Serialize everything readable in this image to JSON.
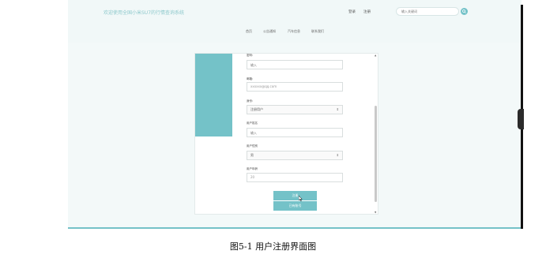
{
  "header": {
    "welcome": "欢迎使用全国小米SU7的行情查询系统",
    "login": "登录",
    "register": "注册",
    "search_placeholder": "输入关键词",
    "search_icon": "search-icon"
  },
  "nav": {
    "items": [
      {
        "label": "首页"
      },
      {
        "label": "公告通知"
      },
      {
        "label": "汽车信息"
      },
      {
        "label": "联系我们"
      }
    ]
  },
  "form": {
    "fields": [
      {
        "label": "密码:",
        "placeholder": "输入"
      },
      {
        "label": "邮箱:",
        "value": "xxxxxx@qq.com"
      },
      {
        "label": "身份:",
        "selected": "注册用户"
      },
      {
        "label": "用户姓名",
        "placeholder": "输入"
      },
      {
        "label": "用户性别",
        "selected": "男"
      },
      {
        "label": "用户年龄",
        "value": "20"
      }
    ],
    "submit_label": "注册",
    "login_label": "已有账号"
  },
  "caption": "图5-1 用户注册界面图",
  "colors": {
    "accent": "#74c2c8"
  }
}
